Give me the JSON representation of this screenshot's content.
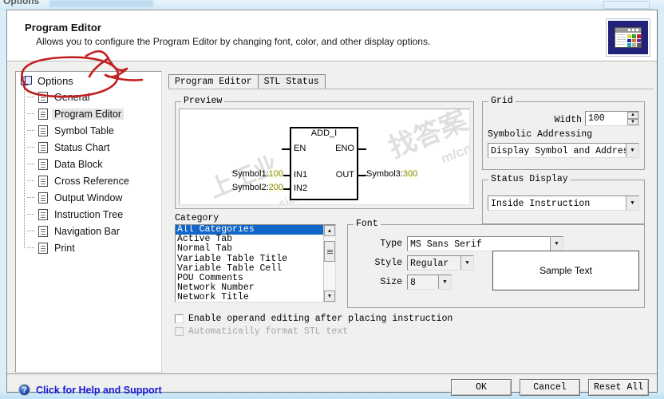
{
  "background_window": {
    "title": "Options",
    "window_button_label": ""
  },
  "header": {
    "title": "Program Editor",
    "description": "Allows you to configure the Program Editor by changing font, color, and other display options.",
    "icon": "display-options-icon"
  },
  "sidebar": {
    "root": {
      "label": "Options",
      "icon": "options-stack-icon"
    },
    "items": [
      {
        "label": "General",
        "icon": "page-icon",
        "selected": false
      },
      {
        "label": "Program Editor",
        "icon": "page-icon",
        "selected": true
      },
      {
        "label": "Symbol Table",
        "icon": "page-icon",
        "selected": false
      },
      {
        "label": "Status Chart",
        "icon": "page-icon",
        "selected": false
      },
      {
        "label": "Data Block",
        "icon": "page-icon",
        "selected": false
      },
      {
        "label": "Cross Reference",
        "icon": "page-icon",
        "selected": false
      },
      {
        "label": "Output Window",
        "icon": "page-icon",
        "selected": false
      },
      {
        "label": "Instruction Tree",
        "icon": "page-icon",
        "selected": false
      },
      {
        "label": "Navigation Bar",
        "icon": "page-icon",
        "selected": false
      },
      {
        "label": "Print",
        "icon": "page-icon",
        "selected": false
      }
    ]
  },
  "help": {
    "icon": "question-mark-icon",
    "label": "Click for Help and Support",
    "color": "#1818d8"
  },
  "tabs": [
    {
      "label": "Program Editor",
      "active": true
    },
    {
      "label": "STL Status",
      "active": false
    }
  ],
  "preview": {
    "group_label": "Preview",
    "block": {
      "name": "ADD_I",
      "pins": {
        "en": "EN",
        "eno": "ENO",
        "in1": "IN1",
        "in2": "IN2",
        "out": "OUT"
      },
      "operands": [
        {
          "symbol": "Symbol1:",
          "value": "100",
          "pin": "IN1"
        },
        {
          "symbol": "Symbol2:",
          "value": "200",
          "pin": "IN2"
        },
        {
          "symbol": "Symbol3:",
          "value": "300",
          "pin": "OUT"
        }
      ],
      "value_color": "#8a8a20"
    },
    "watermark": {
      "line1": "找答案",
      "line2": "m/cn",
      "line3": "上工业",
      "line4": "siemens.co"
    }
  },
  "grid": {
    "group_label": "Grid",
    "width_label": "Width",
    "width_value": "100",
    "symbolic_addressing_label": "Symbolic Addressing",
    "symbolic_addressing_value": "Display Symbol and Address"
  },
  "status_display": {
    "group_label": "Status Display",
    "value": "Inside Instruction"
  },
  "category": {
    "label": "Category",
    "items": [
      {
        "label": "All Categories",
        "selected": true
      },
      {
        "label": "Active Tab",
        "selected": false
      },
      {
        "label": "Normal Tab",
        "selected": false
      },
      {
        "label": "Variable Table Title",
        "selected": false
      },
      {
        "label": "Variable Table Cell",
        "selected": false
      },
      {
        "label": "POU Comments",
        "selected": false
      },
      {
        "label": "Network Number",
        "selected": false
      },
      {
        "label": "Network Title",
        "selected": false
      }
    ],
    "selection_color": "#1266c8"
  },
  "font": {
    "group_label": "Font",
    "type_label": "Type",
    "type_value": "MS Sans Serif",
    "style_label": "Style",
    "style_value": "Regular",
    "size_label": "Size",
    "size_value": "8",
    "sample_text": "Sample Text"
  },
  "checkboxes": [
    {
      "label": "Enable operand editing after placing instruction",
      "checked": false,
      "enabled": true
    },
    {
      "label": "Automatically format STL text",
      "checked": false,
      "enabled": false
    }
  ],
  "footer_buttons": [
    {
      "label": "OK"
    },
    {
      "label": "Cancel"
    },
    {
      "label": "Reset All"
    }
  ],
  "annotation": {
    "type": "hand-drawn-red-marker",
    "color": "#c21f1f",
    "shapes": [
      "ellipse-around-options-root",
      "zigzag-arrow-pointing-right"
    ]
  }
}
